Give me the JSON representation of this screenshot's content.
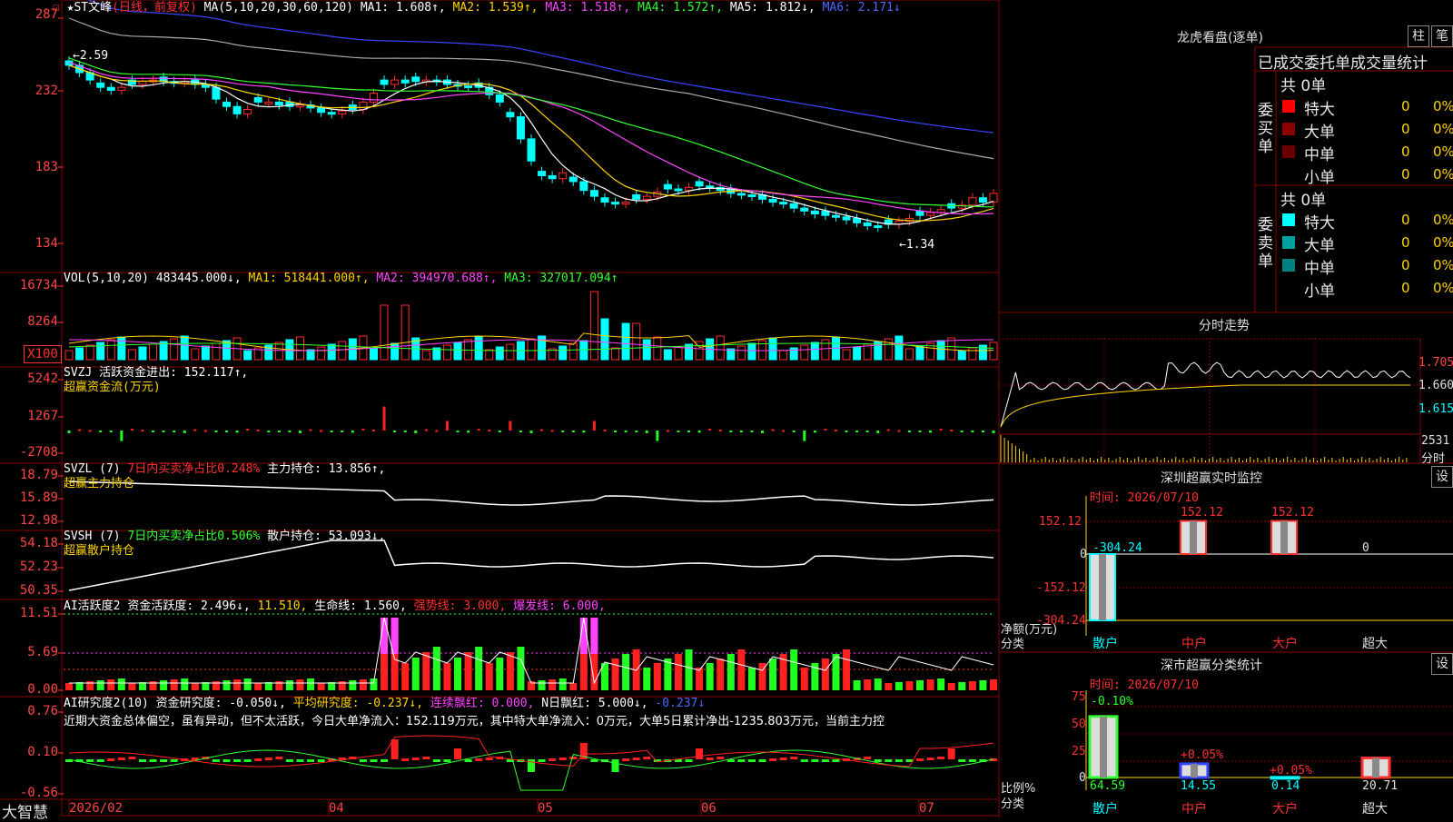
{
  "app": {
    "brand": "大智慧",
    "checkbox_label": "?"
  },
  "main": {
    "stock_name": "★ST文峰",
    "period": "(日线，前复权)",
    "ma_label": "MA(5,10,20,30,60,120)",
    "ma1": "MA1: 1.608↑,",
    "ma2": "MA2: 1.539↑,",
    "ma3": "MA3: 1.518↑,",
    "ma4": "MA4: 1.572↑,",
    "ma5": "MA5: 1.812↓,",
    "ma6": "MA6: 2.171↓",
    "high_mark": "←2.59",
    "low_mark": "←1.34",
    "yticks": [
      "287",
      "232",
      "183",
      "134"
    ]
  },
  "vol": {
    "label": "VOL(5,10,20)",
    "val": "483445.000↓,",
    "ma1": "MA1: 518441.000↑,",
    "ma2": "MA2: 394970.688↑,",
    "ma3": "MA3: 327017.094↑",
    "yticks": [
      "16734",
      "8264"
    ],
    "unit": "X100"
  },
  "svzj": {
    "label": "SVZJ",
    "desc": "活跃资金进出: 152.117↑,",
    "sub": "超赢资金流(万元)",
    "yticks": [
      "5242",
      "1267",
      "-2708"
    ]
  },
  "svzl": {
    "label": "SVZL (7)",
    "desc1": "7日内买卖净占比0.248%",
    "desc2": "主力持仓: 13.856↑,",
    "sub": "超赢主力持仓",
    "yticks": [
      "18.79",
      "15.89",
      "12.98"
    ]
  },
  "svsh": {
    "label": "SVSH (7)",
    "desc1": "7日内买卖净占比0.506%",
    "desc2": "散户持仓: 53.093↓,",
    "sub": "超赢散户持仓",
    "yticks": [
      "54.18",
      "52.23",
      "50.35"
    ]
  },
  "ai1": {
    "label": "AI活跃度2",
    "a": "资金活跃度: 2.496↓,",
    "b": "11.510,",
    "c": "生命线: 1.560,",
    "d": "强势线: 3.000,",
    "e": "爆发线: 6.000,",
    "yticks": [
      "11.51",
      "5.69",
      "0.00"
    ]
  },
  "ai2": {
    "label": "AI研究度2(10)",
    "a": "资金研究度: -0.050↓,",
    "b": "平均研究度: -0.237↓,",
    "c": "连续飘红: 0.000,",
    "d": "N日飘红: 5.000↓,",
    "e": "-0.237↓",
    "comment": "近期大资金总体偏空，虽有异动，但不太活跃，今日大单净流入：152.119万元，其中特大单净流入：0万元，大单5日累计净出-1235.803万元，当前主力控",
    "yticks": [
      "0.76",
      "0.10",
      "-0.56"
    ]
  },
  "xaxis": [
    "2026/02",
    "04",
    "05",
    "06",
    "07"
  ],
  "right": {
    "lhb_title": "龙虎看盘(逐单)",
    "btn_zhu": "柱",
    "btn_bi": "笔",
    "stat_title": "已成交委托单成交量统计",
    "buy_label": "委买单",
    "sell_label": "委卖单",
    "buy_total": "共 0单",
    "sell_total": "共 0单",
    "buy_rows": [
      {
        "name": "特大",
        "n": "0",
        "p": "0%",
        "color": "#ff0000"
      },
      {
        "name": "大单",
        "n": "0",
        "p": "0%",
        "color": "#8b0000"
      },
      {
        "name": "中单",
        "n": "0",
        "p": "0%",
        "color": "#6a0000"
      },
      {
        "name": "小单",
        "n": "0",
        "p": "0%",
        "color": "#000000"
      }
    ],
    "sell_rows": [
      {
        "name": "特大",
        "n": "0",
        "p": "0%",
        "color": "#00ffff"
      },
      {
        "name": "大单",
        "n": "0",
        "p": "0%",
        "color": "#00a0a0"
      },
      {
        "name": "中单",
        "n": "0",
        "p": "0%",
        "color": "#008080"
      },
      {
        "name": "小单",
        "n": "0",
        "p": "0%",
        "color": "#000000"
      }
    ],
    "fs_title": "分时走势",
    "fs_yticks": [
      "1.705",
      "1.660",
      "1.615"
    ],
    "fs_vol": "2531",
    "fs_vol_label": "分时",
    "sz_title": "深圳超赢实时监控",
    "sz_btn": "设",
    "sz_time": "时间: 2026/07/10",
    "sz_yticks": [
      "152.12",
      "0",
      "-152.12",
      "-304.24"
    ],
    "sz_vals": [
      "-304.24",
      "152.12",
      "152.12",
      "0"
    ],
    "sz_ylabel": "净额(万元)",
    "sz_xlabel": "分类",
    "cats": [
      "散户",
      "中户",
      "大户",
      "超大"
    ],
    "cls_title": "深市超赢分类统计",
    "cls_btn": "设",
    "cls_time": "时间: 2026/07/10",
    "cls_yticks": [
      "75",
      "50",
      "25",
      "0"
    ],
    "cls_pct": [
      "-0.10%",
      "+0.05%",
      "+0.05%"
    ],
    "cls_vals": [
      "64.59",
      "14.55",
      "0.14",
      "20.71"
    ],
    "cls_ylabel": "比例%",
    "cls_xlabel": "分类"
  },
  "colors": {
    "up": "#ff2a2a",
    "down": "#00ffff",
    "grid": "#8a0000",
    "ma1": "#ffffff",
    "ma2": "#ffd400",
    "ma3": "#ff44ff",
    "ma4": "#33ff33",
    "ma5": "#aaaaaa",
    "ma6": "#3a44ff"
  },
  "chart_data": [
    {
      "type": "candlestick",
      "title": "★ST文峰 (日线，前复权)",
      "ylim": [
        1.3,
        2.9
      ],
      "x": [
        "2026/02",
        "04",
        "05",
        "06",
        "07"
      ],
      "series": [
        {
          "name": "MA1",
          "last": 1.608
        },
        {
          "name": "MA2",
          "last": 1.539
        },
        {
          "name": "MA3",
          "last": 1.518
        },
        {
          "name": "MA4",
          "last": 1.572
        },
        {
          "name": "MA5",
          "last": 1.812
        },
        {
          "name": "MA6",
          "last": 2.171
        }
      ],
      "close": [
        2.55,
        2.5,
        2.45,
        2.4,
        2.38,
        2.4,
        2.42,
        2.44,
        2.45,
        2.44,
        2.43,
        2.44,
        2.42,
        2.4,
        2.32,
        2.27,
        2.22,
        2.25,
        2.3,
        2.3,
        2.28,
        2.27,
        2.28,
        2.26,
        2.23,
        2.22,
        2.24,
        2.25,
        2.3,
        2.36,
        2.42,
        2.45,
        2.43,
        2.44,
        2.45,
        2.44,
        2.42,
        2.41,
        2.4,
        2.4,
        2.35,
        2.3,
        2.2,
        2.05,
        1.9,
        1.8,
        1.78,
        1.82,
        1.76,
        1.7,
        1.66,
        1.62,
        1.61,
        1.62,
        1.64,
        1.66,
        1.69,
        1.71,
        1.7,
        1.72,
        1.73,
        1.72,
        1.7,
        1.68,
        1.67,
        1.66,
        1.64,
        1.62,
        1.61,
        1.58,
        1.56,
        1.54,
        1.53,
        1.52,
        1.5,
        1.48,
        1.46,
        1.45,
        1.47,
        1.49,
        1.51,
        1.53,
        1.55,
        1.57,
        1.58,
        1.6,
        1.65,
        1.62,
        1.68
      ]
    },
    {
      "type": "bar",
      "title": "VOL(5,10,20)",
      "series": [
        {
          "name": "MA1",
          "last": 518441.0
        },
        {
          "name": "MA2",
          "last": 394970.688
        },
        {
          "name": "MA3",
          "last": 327017.094
        }
      ],
      "ylim": [
        0,
        16734
      ]
    },
    {
      "type": "bar",
      "title": "SVZJ 活跃资金进出",
      "last": 152.117,
      "ylim": [
        -2708,
        5242
      ]
    },
    {
      "type": "line",
      "title": "SVZL 主力持仓",
      "last": 13.856,
      "ylim": [
        12.98,
        18.79
      ]
    },
    {
      "type": "line",
      "title": "SVSH 散户持仓",
      "last": 53.093,
      "ylim": [
        50.35,
        54.18
      ]
    },
    {
      "type": "bar",
      "title": "AI活跃度2",
      "series": [
        {
          "name": "资金活跃度",
          "last": 2.496
        },
        {
          "name": "生命线",
          "last": 1.56
        },
        {
          "name": "强势线",
          "last": 3.0
        },
        {
          "name": "爆发线",
          "last": 6.0
        }
      ],
      "ylim": [
        0,
        11.51
      ]
    },
    {
      "type": "bar",
      "title": "AI研究度2(10)",
      "series": [
        {
          "name": "资金研究度",
          "last": -0.05
        },
        {
          "name": "平均研究度",
          "last": -0.237
        }
      ],
      "ylim": [
        -0.56,
        0.76
      ]
    },
    {
      "type": "bar",
      "title": "深圳超赢实时监控",
      "categories": [
        "散户",
        "中户",
        "大户",
        "超大"
      ],
      "values": [
        -304.24,
        152.12,
        152.12,
        0
      ],
      "ylim": [
        -304.24,
        152.12
      ]
    },
    {
      "type": "bar",
      "title": "深市超赢分类统计",
      "categories": [
        "散户",
        "中户",
        "大户",
        "超大"
      ],
      "values": [
        64.59,
        14.55,
        0.14,
        20.71
      ],
      "ylim": [
        0,
        75
      ]
    }
  ]
}
